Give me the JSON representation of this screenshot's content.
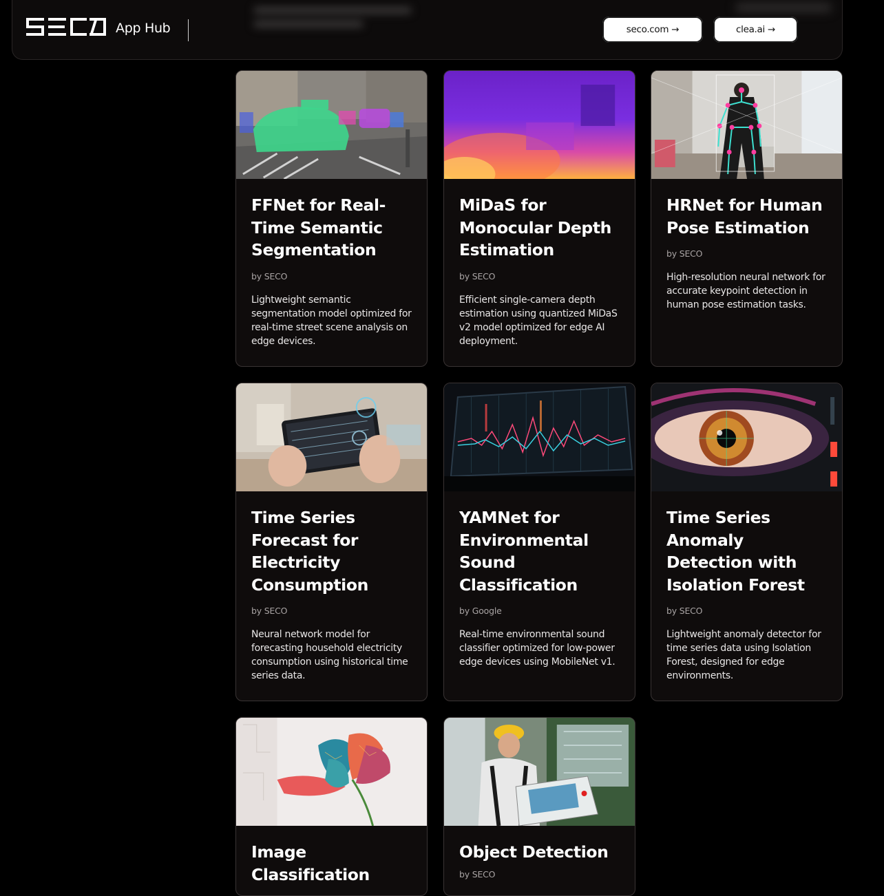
{
  "header": {
    "logo_text": "SECO",
    "app_name": "App Hub",
    "links": [
      {
        "label": "seco.com →"
      },
      {
        "label": "clea.ai →"
      }
    ]
  },
  "cards": [
    {
      "title": "FFNet for Real-Time Semantic Segmentation",
      "by": "by SECO",
      "description": "Lightweight semantic segmentation model optimized for real-time street scene analysis on edge devices."
    },
    {
      "title": "MiDaS for Monocular Depth Estimation",
      "by": "by SECO",
      "description": "Efficient single-camera depth estimation using quantized MiDaS v2 model optimized for edge AI deployment."
    },
    {
      "title": "HRNet for Human Pose Estimation",
      "by": "by SECO",
      "description": "High-resolution neural network for accurate keypoint detection in human pose estimation tasks."
    },
    {
      "title": "Time Series Forecast for Electricity Consumption",
      "by": "by SECO",
      "description": "Neural network model for forecasting household electricity consumption using historical time series data."
    },
    {
      "title": "YAMNet for Environmental Sound Classification",
      "by": "by Google",
      "description": "Real-time environmental sound classifier optimized for low-power edge devices using MobileNet v1."
    },
    {
      "title": "Time Series Anomaly Detection with Isolation Forest",
      "by": "by SECO",
      "description": "Lightweight anomaly detector for time series data using Isolation Forest, designed for edge environments."
    },
    {
      "title": "Image Classification",
      "by": "",
      "description": ""
    },
    {
      "title": "Object Detection",
      "by": "by SECO",
      "description": ""
    }
  ],
  "colors": {
    "page_bg": "#000000",
    "card_bg": "#0f0c0c",
    "card_border": "#3a3434",
    "pill_bg": "#ffffff"
  }
}
